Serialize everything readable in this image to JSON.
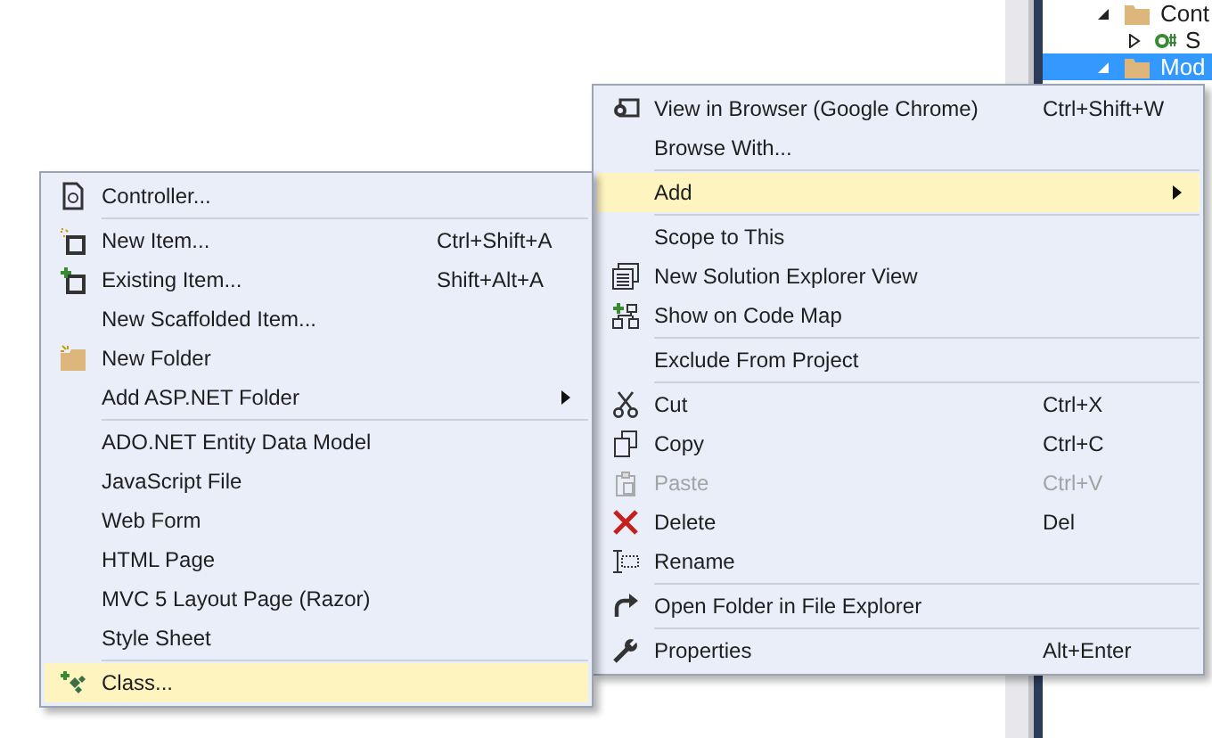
{
  "solution_explorer": {
    "rows": [
      {
        "label": "Cont",
        "expanded": true,
        "selected": false,
        "kind": "folder"
      },
      {
        "label": "S",
        "expanded": false,
        "selected": false,
        "kind": "csharp"
      },
      {
        "label": "Mod",
        "expanded": true,
        "selected": true,
        "kind": "folder"
      }
    ]
  },
  "context_menu": {
    "items": [
      {
        "kind": "item",
        "label": "View in Browser (Google Chrome)",
        "shortcut": "Ctrl+Shift+W",
        "disabled": false,
        "selected": false
      },
      {
        "kind": "item",
        "label": "Browse With...",
        "disabled": false,
        "selected": false
      },
      {
        "kind": "separator"
      },
      {
        "kind": "submenu",
        "label": "Add",
        "disabled": false,
        "selected": true
      },
      {
        "kind": "separator"
      },
      {
        "kind": "item",
        "label": "Scope to This",
        "disabled": false,
        "selected": false
      },
      {
        "kind": "item",
        "label": "New Solution Explorer View",
        "disabled": false,
        "selected": false
      },
      {
        "kind": "item",
        "label": "Show on Code Map",
        "disabled": false,
        "selected": false
      },
      {
        "kind": "separator"
      },
      {
        "kind": "item",
        "label": "Exclude From Project",
        "disabled": false,
        "selected": false
      },
      {
        "kind": "separator"
      },
      {
        "kind": "item",
        "label": "Cut",
        "shortcut": "Ctrl+X",
        "disabled": false,
        "selected": false
      },
      {
        "kind": "item",
        "label": "Copy",
        "shortcut": "Ctrl+C",
        "disabled": false,
        "selected": false
      },
      {
        "kind": "item",
        "label": "Paste",
        "shortcut": "Ctrl+V",
        "disabled": true,
        "selected": false
      },
      {
        "kind": "item",
        "label": "Delete",
        "shortcut": "Del",
        "disabled": false,
        "selected": false
      },
      {
        "kind": "item",
        "label": "Rename",
        "disabled": false,
        "selected": false
      },
      {
        "kind": "separator"
      },
      {
        "kind": "item",
        "label": "Open Folder in File Explorer",
        "disabled": false,
        "selected": false
      },
      {
        "kind": "separator"
      },
      {
        "kind": "item",
        "label": "Properties",
        "shortcut": "Alt+Enter",
        "disabled": false,
        "selected": false
      }
    ]
  },
  "add_submenu": {
    "items": [
      {
        "kind": "item",
        "label": "Controller...",
        "disabled": false,
        "selected": false
      },
      {
        "kind": "separator"
      },
      {
        "kind": "item",
        "label": "New Item...",
        "shortcut": "Ctrl+Shift+A",
        "disabled": false,
        "selected": false
      },
      {
        "kind": "item",
        "label": "Existing Item...",
        "shortcut": "Shift+Alt+A",
        "disabled": false,
        "selected": false
      },
      {
        "kind": "item",
        "label": "New Scaffolded Item...",
        "disabled": false,
        "selected": false
      },
      {
        "kind": "item",
        "label": "New Folder",
        "disabled": false,
        "selected": false
      },
      {
        "kind": "submenu",
        "label": "Add ASP.NET Folder",
        "disabled": false,
        "selected": false
      },
      {
        "kind": "separator"
      },
      {
        "kind": "item",
        "label": "ADO.NET Entity Data Model",
        "disabled": false,
        "selected": false
      },
      {
        "kind": "item",
        "label": "JavaScript File",
        "disabled": false,
        "selected": false
      },
      {
        "kind": "item",
        "label": "Web Form",
        "disabled": false,
        "selected": false
      },
      {
        "kind": "item",
        "label": "HTML Page",
        "disabled": false,
        "selected": false
      },
      {
        "kind": "item",
        "label": "MVC 5 Layout Page (Razor)",
        "disabled": false,
        "selected": false
      },
      {
        "kind": "item",
        "label": "Style Sheet",
        "disabled": false,
        "selected": false
      },
      {
        "kind": "separator"
      },
      {
        "kind": "item",
        "label": "Class...",
        "disabled": false,
        "selected": true
      }
    ]
  }
}
